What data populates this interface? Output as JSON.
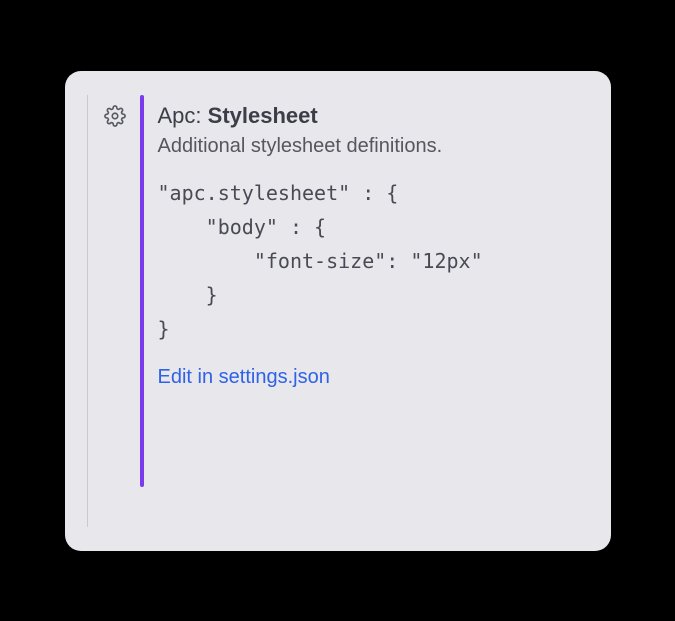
{
  "setting": {
    "title_prefix": "Apc:",
    "title_name": "Stylesheet",
    "description": "Additional stylesheet definitions.",
    "code": "\"apc.stylesheet\" : {\n    \"body\" : {\n        \"font-size\": \"12px\"\n    }\n}",
    "edit_link_label": "Edit in settings.json"
  }
}
